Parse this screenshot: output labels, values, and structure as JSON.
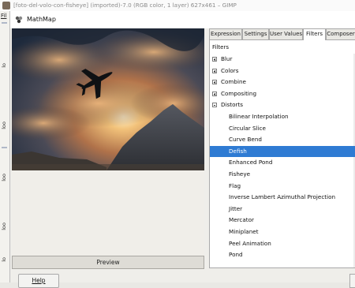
{
  "gimp_window": {
    "title": "[foto-del-volo-con-fisheye] (imported)-7.0 (RGB color, 1 layer) 627x461 – GIMP",
    "menu_first": "Fil",
    "strip_labels": [
      "lo",
      "loo",
      "loo",
      "loo",
      "lo"
    ]
  },
  "dialog": {
    "title": "MathMap",
    "preview_label": "Preview",
    "help_label": "Help",
    "tabs": [
      "Expression",
      "Settings",
      "User Values",
      "Filters",
      "Composer"
    ],
    "active_tab": "Filters",
    "tree_header": "Filters",
    "tree": [
      {
        "label": "Blur",
        "level": 0,
        "expander": "plus"
      },
      {
        "label": "Colors",
        "level": 0,
        "expander": "plus"
      },
      {
        "label": "Combine",
        "level": 0,
        "expander": "plus"
      },
      {
        "label": "Compositing",
        "level": 0,
        "expander": "plus"
      },
      {
        "label": "Distorts",
        "level": 0,
        "expander": "minus"
      },
      {
        "label": "Bilinear Interpolation",
        "level": 1
      },
      {
        "label": "Circular Slice",
        "level": 1
      },
      {
        "label": "Curve Bend",
        "level": 1
      },
      {
        "label": "Defish",
        "level": 1,
        "selected": true
      },
      {
        "label": "Enhanced Pond",
        "level": 1
      },
      {
        "label": "Fisheye",
        "level": 1
      },
      {
        "label": "Flag",
        "level": 1
      },
      {
        "label": "Inverse Lambert Azimuthal Projection",
        "level": 1
      },
      {
        "label": "Jitter",
        "level": 1
      },
      {
        "label": "Mercator",
        "level": 1
      },
      {
        "label": "Miniplanet",
        "level": 1
      },
      {
        "label": "Peel Animation",
        "level": 1
      },
      {
        "label": "Pond",
        "level": 1
      }
    ],
    "colors": {
      "selection": "#2f7bd3",
      "sky_dark": "#1e2a3c",
      "sun_glow": "#f2c27a"
    }
  }
}
